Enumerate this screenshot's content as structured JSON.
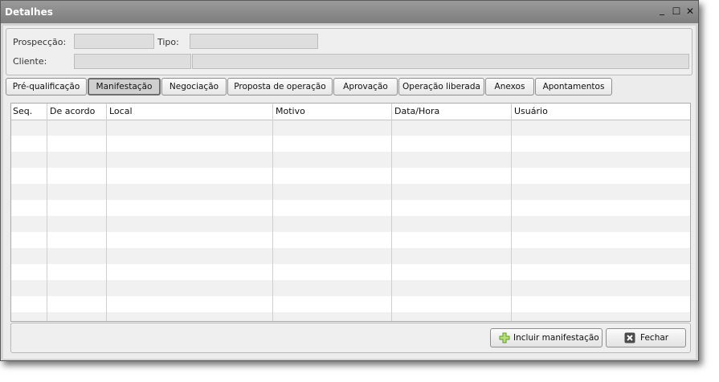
{
  "window": {
    "title": "Detalhes",
    "minimize_glyph": "_",
    "maximize_glyph": "☐",
    "close_glyph": "✕"
  },
  "form": {
    "prospeccao_label": "Prospecção:",
    "tipo_label": "Tipo:",
    "cliente_label": "Cliente:",
    "prospeccao_value": "",
    "tipo_value": "",
    "cliente_code_value": "",
    "cliente_name_value": ""
  },
  "tabs": [
    {
      "label": "Pré-qualificação"
    },
    {
      "label": "Manifestação",
      "active": true
    },
    {
      "label": "Negociação"
    },
    {
      "label": "Proposta de operação"
    },
    {
      "label": "Aprovação"
    },
    {
      "label": "Operação liberada"
    },
    {
      "label": "Anexos"
    },
    {
      "label": "Apontamentos"
    }
  ],
  "grid": {
    "columns": [
      "Seq.",
      "De acordo",
      "Local",
      "Motivo",
      "Data/Hora",
      "Usuário"
    ],
    "rows": []
  },
  "buttons": {
    "add_label": "Incluir manifestação",
    "add_icon": "plus-icon",
    "close_label": "Fechar",
    "close_icon": "close-x-icon"
  }
}
